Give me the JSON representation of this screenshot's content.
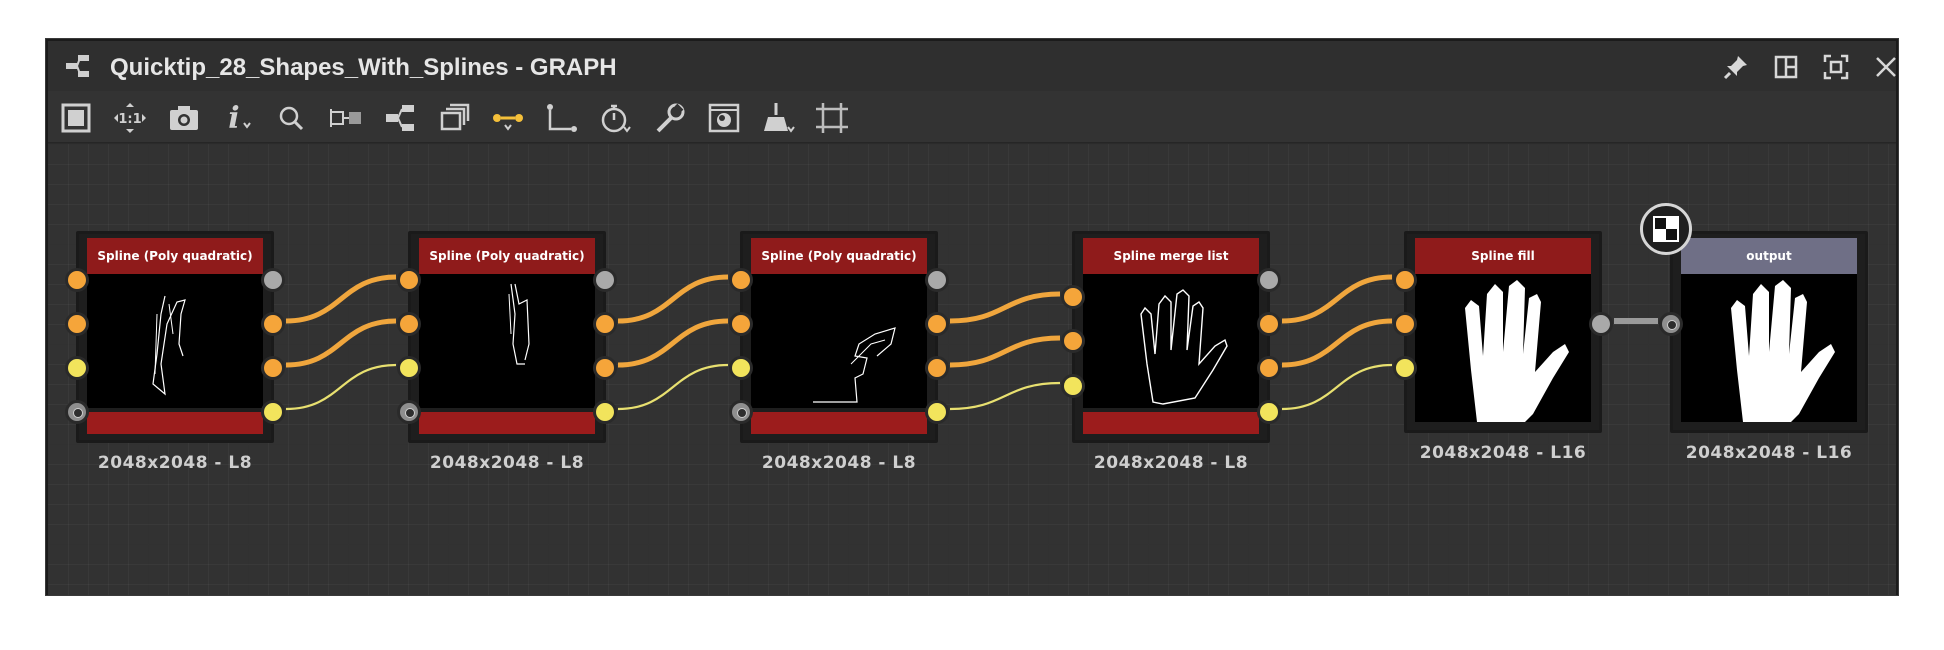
{
  "window": {
    "title": "Quicktip_28_Shapes_With_Splines - GRAPH",
    "icons": [
      "graph-icon",
      "pin-icon",
      "split-view-icon",
      "maximize-icon",
      "close-icon"
    ]
  },
  "toolbar": {
    "tools": [
      {
        "name": "frame-all-tool",
        "icon": "frame-icon"
      },
      {
        "name": "zoom-1-1-tool",
        "icon": "zoom-1-1-icon",
        "label": "1:1"
      },
      {
        "name": "screenshot-tool",
        "icon": "camera-icon"
      },
      {
        "name": "info-tool",
        "icon": "info-icon",
        "label": "i"
      },
      {
        "name": "search-tool",
        "icon": "search-icon"
      },
      {
        "name": "node-display-tool",
        "icon": "node-display-icon"
      },
      {
        "name": "graph-layout-tool",
        "icon": "graph-layout-icon"
      },
      {
        "name": "frames-tool",
        "icon": "stack-icon"
      },
      {
        "name": "link-style-tool",
        "icon": "link-style-icon"
      },
      {
        "name": "link-routing-tool",
        "icon": "routing-icon"
      },
      {
        "name": "timing-tool",
        "icon": "stopwatch-icon"
      },
      {
        "name": "tools-menu",
        "icon": "wrench-icon"
      },
      {
        "name": "preview-tool",
        "icon": "preview-icon"
      },
      {
        "name": "clean-tool",
        "icon": "broom-icon"
      },
      {
        "name": "crop-tool",
        "icon": "crop-icon"
      }
    ],
    "accent": "#f5c03a"
  },
  "graph": {
    "nodes": [
      {
        "id": "n1",
        "title": "Spline (Poly quadratic)",
        "resolution": "2048x2048 - L8",
        "header_color": "#8f1b1b",
        "thumb": "spline-a"
      },
      {
        "id": "n2",
        "title": "Spline (Poly quadratic)",
        "resolution": "2048x2048 - L8",
        "header_color": "#8f1b1b",
        "thumb": "spline-b"
      },
      {
        "id": "n3",
        "title": "Spline (Poly quadratic)",
        "resolution": "2048x2048 - L8",
        "header_color": "#8f1b1b",
        "thumb": "spline-c"
      },
      {
        "id": "n4",
        "title": "Spline merge list",
        "resolution": "2048x2048 - L8",
        "header_color": "#8f1b1b",
        "thumb": "hand-outline"
      },
      {
        "id": "n5",
        "title": "Spline fill",
        "resolution": "2048x2048 - L16",
        "header_color": "#8f1b1b",
        "thumb": "hand-filled"
      },
      {
        "id": "n6",
        "title": "output",
        "resolution": "2048x2048 - L16",
        "header_color": "#6f6f86",
        "thumb": "hand-filled"
      }
    ],
    "colors": {
      "orange_wire": "#f0a63d",
      "yellow_wire": "#e8e070",
      "gray_wire": "#9a9a9a",
      "footer_red": "#9c1c1c"
    },
    "output_badge_icon": "checker-icon"
  }
}
